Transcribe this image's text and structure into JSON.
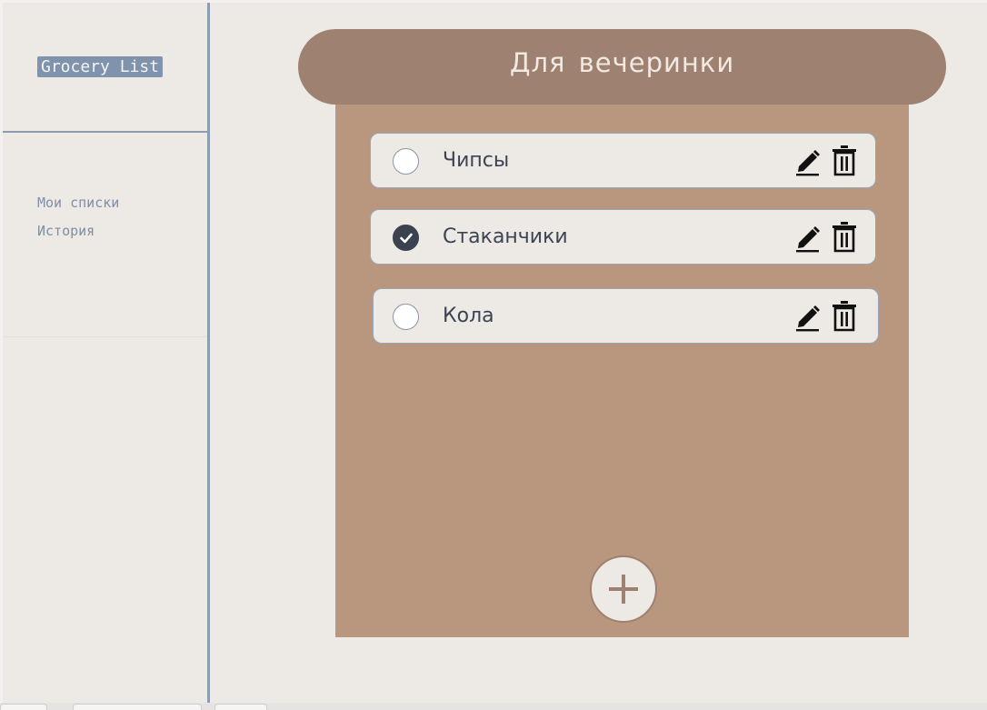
{
  "sidebar": {
    "brand": "Grocery List",
    "nav": [
      {
        "label": "Мои списки"
      },
      {
        "label": "История"
      }
    ]
  },
  "list": {
    "title": "Для вечеринки",
    "items": [
      {
        "label": "Чипсы",
        "checked": false
      },
      {
        "label": "Стаканчики",
        "checked": true
      },
      {
        "label": "Кола",
        "checked": false
      }
    ]
  },
  "icons": {
    "edit": "pencil-icon",
    "delete": "trash-icon",
    "add": "plus-icon",
    "check": "checkmark-icon"
  },
  "colors": {
    "sidebar_accent": "#8b9cb3",
    "header": "#9e8171",
    "panel": "#b9967e",
    "background": "#ede9e4",
    "checked": "#3a4250"
  }
}
